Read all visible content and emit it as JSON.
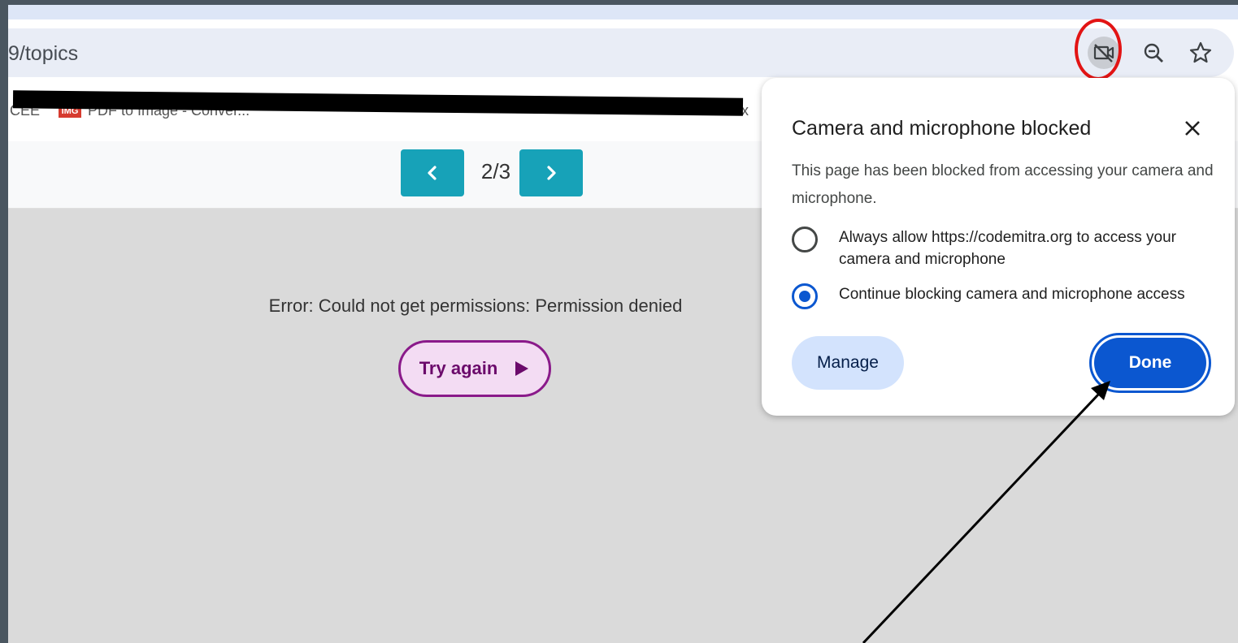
{
  "browser": {
    "url_fragment": "9/topics",
    "bookmarks": [
      {
        "label": "CEE"
      },
      {
        "label": "PDF to Image - Conver..."
      },
      {
        "label": "x"
      }
    ]
  },
  "pager": {
    "prev_icon": "chevron-left-icon",
    "label": "2/3",
    "next_icon": "chevron-right-icon"
  },
  "page": {
    "error_message": "Error: Could not get permissions: Permission denied",
    "try_again_label": "Try again"
  },
  "permission_popup": {
    "title": "Camera and microphone blocked",
    "description": "This page has been blocked from accessing your camera and microphone.",
    "options": [
      {
        "label": "Always allow https://codemitra.org to access your camera and microphone",
        "selected": false
      },
      {
        "label": "Continue blocking camera and microphone access",
        "selected": true
      }
    ],
    "manage_label": "Manage",
    "done_label": "Done"
  },
  "colors": {
    "accent_blue": "#0b57d0",
    "pager_teal": "#17a2b8",
    "try_again_purple": "#8a1a8a",
    "annotation_red": "#e21414"
  }
}
